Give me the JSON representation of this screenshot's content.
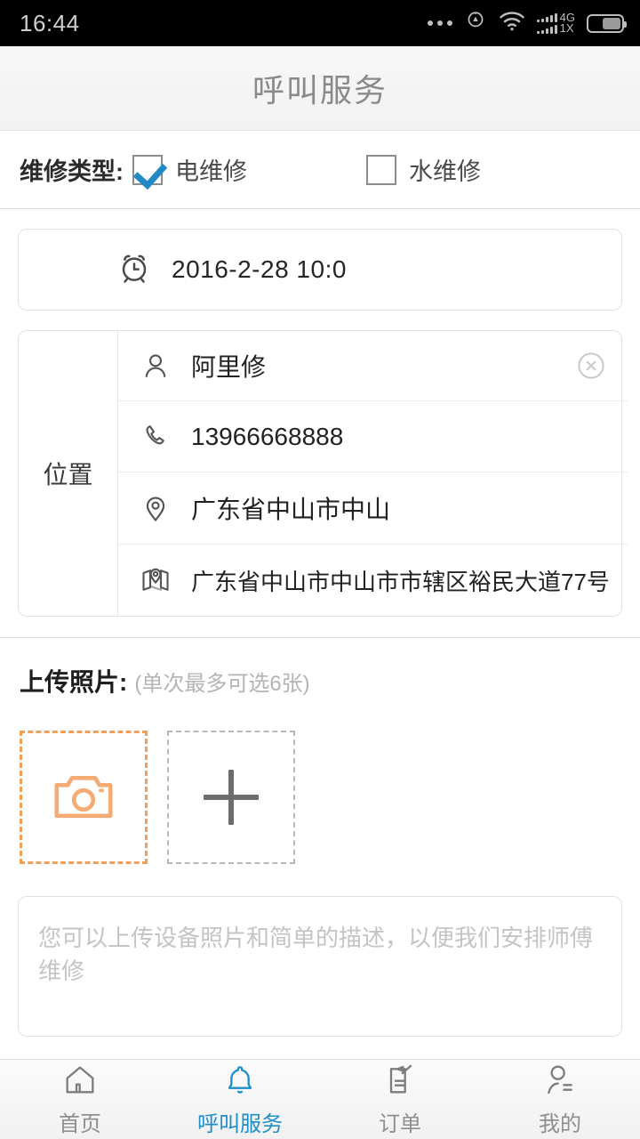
{
  "status_bar": {
    "time": "16:44",
    "icons": [
      "more-dots-icon",
      "alarm-location-icon",
      "wifi-icon",
      "signal-bars-icon",
      "battery-icon"
    ],
    "network_primary": "4G",
    "network_secondary": "1X"
  },
  "header": {
    "title": "呼叫服务"
  },
  "repair_type": {
    "label": "维修类型:",
    "options": [
      {
        "label": "电维修",
        "checked": true
      },
      {
        "label": "水维修",
        "checked": false
      }
    ]
  },
  "datetime": {
    "icon": "alarm-clock-icon",
    "value": "2016-2-28 10:0"
  },
  "location": {
    "label": "位置",
    "rows": [
      {
        "icon": "person-icon",
        "value": "阿里修",
        "has_clear": true
      },
      {
        "icon": "phone-icon",
        "value": "13966668888",
        "has_clear": false
      },
      {
        "icon": "map-pin-icon",
        "value": "广东省中山市中山",
        "has_clear": false
      },
      {
        "icon": "map-location-icon",
        "value": "广东省中山市中山市市辖区裕民大道77号",
        "has_clear": false
      }
    ],
    "clear_icon": "clear-circle-icon"
  },
  "upload": {
    "title": "上传照片:",
    "hint": "(单次最多可选6张)",
    "camera_box_icon": "camera-icon",
    "add_box_icon": "plus-icon"
  },
  "description": {
    "value": "",
    "placeholder": "您可以上传设备照片和简单的描述，以便我们安排师傅维修"
  },
  "tabbar": {
    "items": [
      {
        "label": "首页",
        "icon": "home-icon",
        "active": false
      },
      {
        "label": "呼叫服务",
        "icon": "bell-icon",
        "active": true
      },
      {
        "label": "订单",
        "icon": "order-clipboard-icon",
        "active": false
      },
      {
        "label": "我的",
        "icon": "profile-icon",
        "active": false
      }
    ]
  },
  "colors": {
    "accent_blue": "#1d8fc9",
    "checkbox_blue": "#2389c4",
    "camera_orange": "#f0a05a",
    "text_dark": "#222222",
    "text_muted": "#8e8e8e",
    "placeholder": "#c4c4c4"
  }
}
